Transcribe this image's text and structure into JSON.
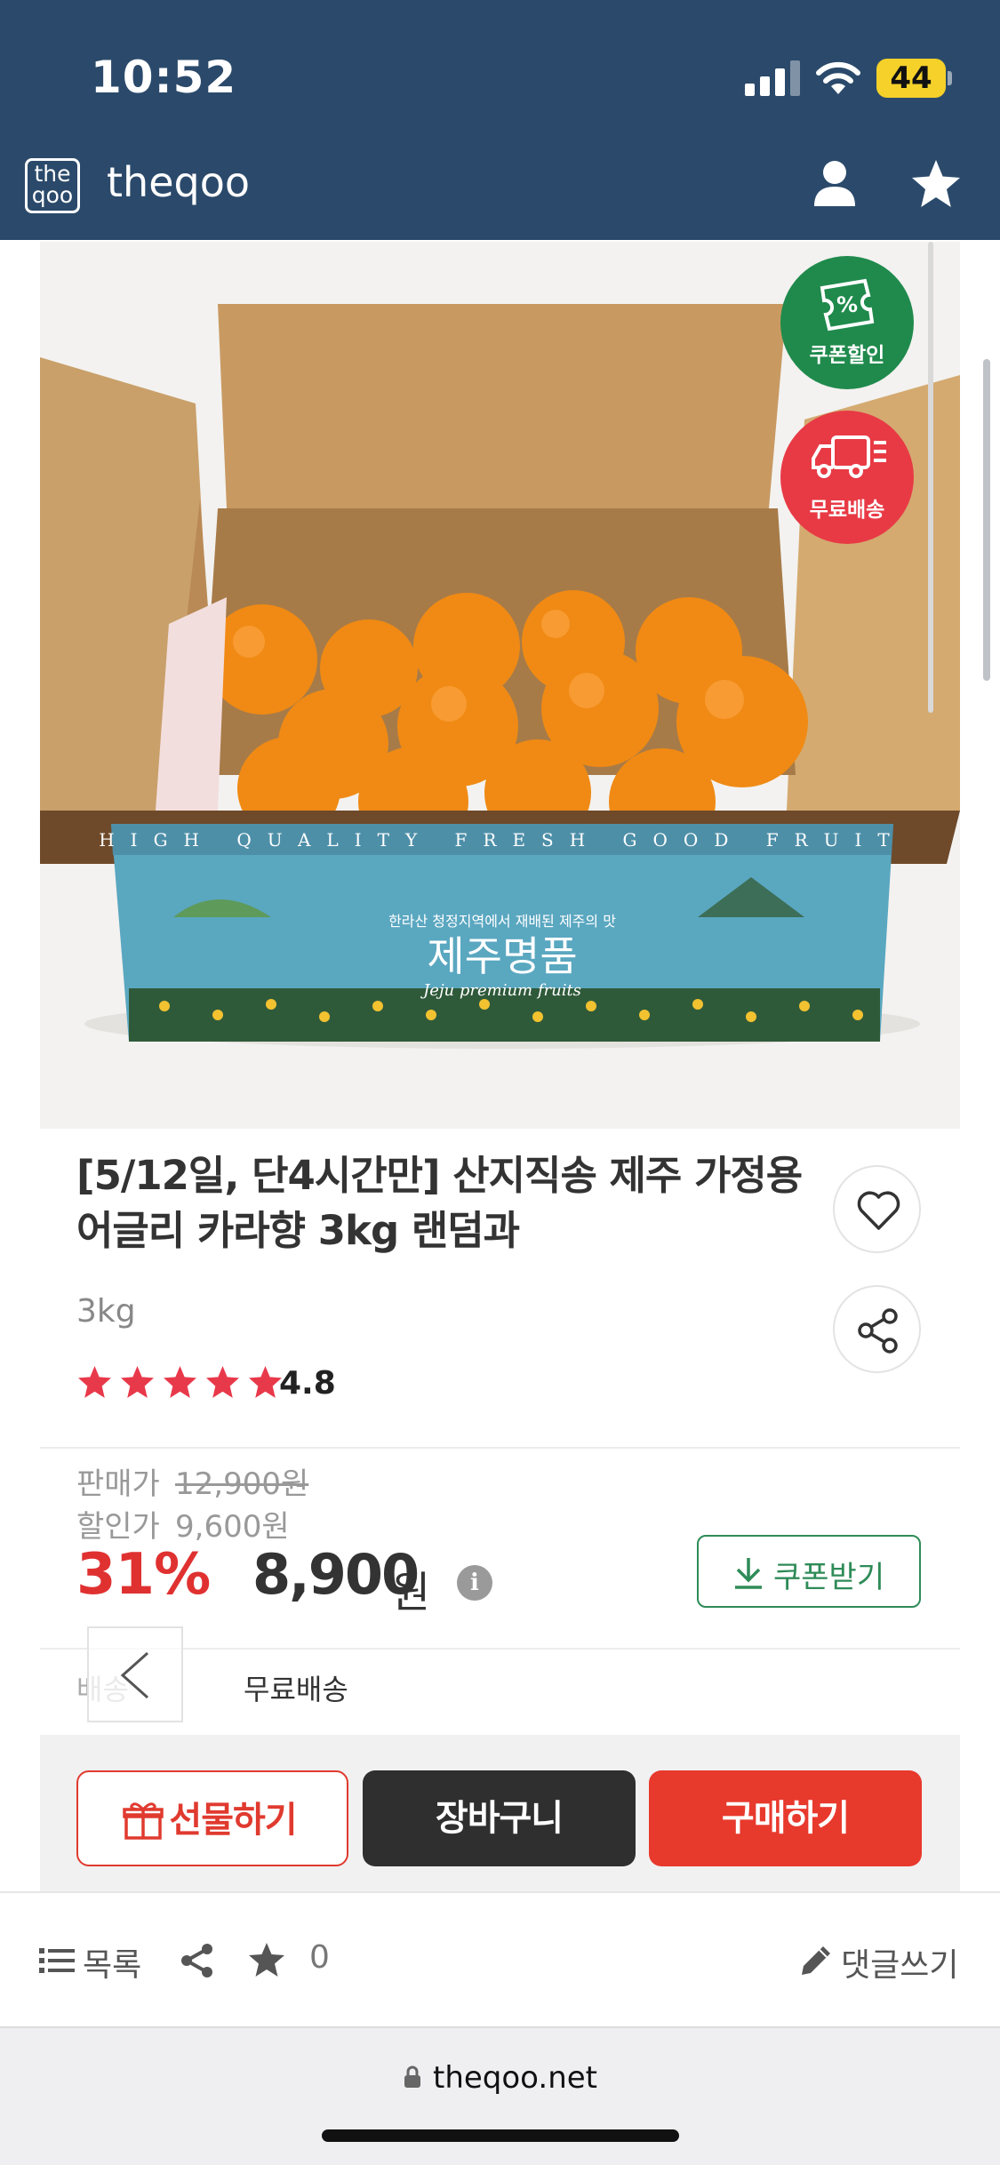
{
  "status_bar": {
    "time": "10:52",
    "battery": "44"
  },
  "app": {
    "logo_text": "the\nqoo",
    "title": "theqoo"
  },
  "badges": {
    "coupon": "쿠폰할인",
    "free_shipping": "무료배송",
    "coupon_symbol": "%"
  },
  "product": {
    "title": "[5/12일, 단4시간만] 산지직송 제주 가정용 어글리 카라향 3kg 랜덤과",
    "option": "3kg",
    "rating": "4.8",
    "rating_stars": 5,
    "price_label": "판매가",
    "price": "12,900원",
    "sale_label": "할인가",
    "sale_price": "9,600원",
    "discount": "31%",
    "final_price": "8,900",
    "final_unit": "원",
    "info_symbol": "i",
    "coupon_button": "쿠폰받기",
    "shipping_label": "배송",
    "shipping_value": "무료배송"
  },
  "image_printing": {
    "band": "HIGH QUALITY FRESH GOOD FRUIT",
    "small": "한라산 청정지역에서 재배된 제주의 맛",
    "brand": "제주명품",
    "sub": "Jeju premium fruits"
  },
  "actions": {
    "gift": "선물하기",
    "cart": "장바구니",
    "buy": "구매하기"
  },
  "toolbar": {
    "list": "목록",
    "count": "0",
    "comment": "댓글쓰기"
  },
  "browser": {
    "url": "theqoo.net"
  },
  "colors": {
    "header": "#2b4a6b",
    "accent_red": "#e8392d",
    "coupon_green": "#1f8a4c",
    "badge_red": "#e83a45"
  }
}
